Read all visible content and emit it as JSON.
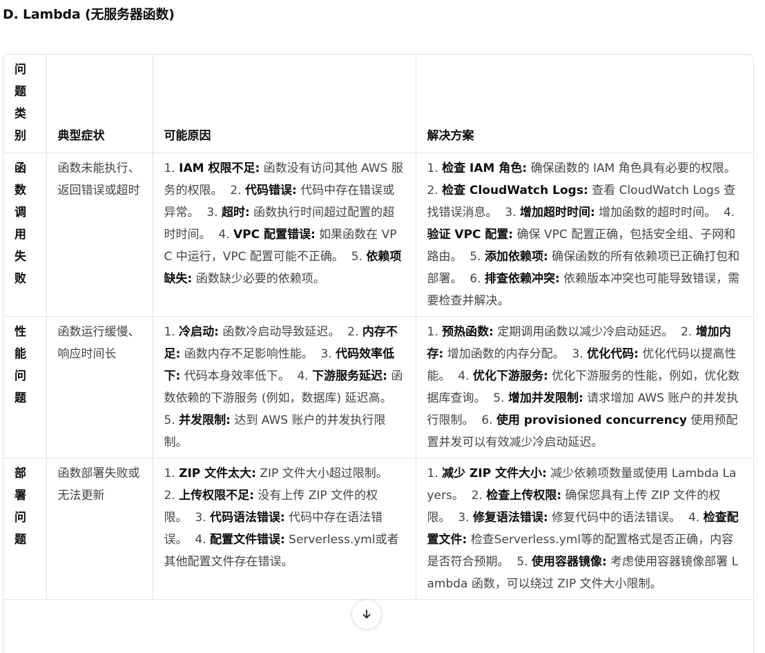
{
  "heading": "D. Lambda (无服务器函数)",
  "table": {
    "headers": [
      "问题类别",
      "典型症状",
      "可能原因",
      "解决方案"
    ],
    "rows": [
      {
        "category": "函数调用失败",
        "symptom": "函数未能执行、返回错误或超时",
        "causes": [
          {
            "num": "1.",
            "title": "IAM 权限不足:",
            "text": "函数没有访问其他 AWS 服务的权限。"
          },
          {
            "num": "2.",
            "title": "代码错误:",
            "text": "代码中存在错误或异常。"
          },
          {
            "num": "3.",
            "title": "超时:",
            "text": "函数执行时间超过配置的超时时间。"
          },
          {
            "num": "4.",
            "title": "VPC 配置错误:",
            "text": "如果函数在 VPC 中运行，VPC 配置可能不正确。"
          },
          {
            "num": "5.",
            "title": "依赖项缺失:",
            "text": "函数缺少必要的依赖项。"
          }
        ],
        "solutions": [
          {
            "num": "1.",
            "title": "检查 IAM 角色:",
            "text": "确保函数的 IAM 角色具有必要的权限。"
          },
          {
            "num": "2.",
            "title": "检查 CloudWatch Logs:",
            "text": "查看 CloudWatch Logs 查找错误消息。"
          },
          {
            "num": "3.",
            "title": "增加超时时间:",
            "text": "增加函数的超时时间。"
          },
          {
            "num": "4.",
            "title": "验证 VPC 配置:",
            "text": "确保 VPC 配置正确，包括安全组、子网和路由。"
          },
          {
            "num": "5.",
            "title": "添加依赖项:",
            "text": "确保函数的所有依赖项已正确打包和部署。"
          },
          {
            "num": "6.",
            "title": "排查依赖冲突:",
            "text": "依赖版本冲突也可能导致错误，需要检查并解决。"
          }
        ]
      },
      {
        "category": "性能问题",
        "symptom": "函数运行缓慢、响应时间长",
        "causes": [
          {
            "num": "1.",
            "title": "冷启动:",
            "text": "函数冷启动导致延迟。"
          },
          {
            "num": "2.",
            "title": "内存不足:",
            "text": "函数内存不足影响性能。"
          },
          {
            "num": "3.",
            "title": "代码效率低下:",
            "text": "代码本身效率低下。"
          },
          {
            "num": "4.",
            "title": "下游服务延迟:",
            "text": "函数依赖的下游服务 (例如，数据库) 延迟高。"
          },
          {
            "num": "5.",
            "title": "并发限制:",
            "text": "达到 AWS 账户的并发执行限制。"
          }
        ],
        "solutions": [
          {
            "num": "1.",
            "title": "预热函数:",
            "text": "定期调用函数以减少冷启动延迟。"
          },
          {
            "num": "2.",
            "title": "增加内存:",
            "text": "增加函数的内存分配。"
          },
          {
            "num": "3.",
            "title": "优化代码:",
            "text": "优化代码以提高性能。"
          },
          {
            "num": "4.",
            "title": "优化下游服务:",
            "text": "优化下游服务的性能，例如，优化数据库查询。"
          },
          {
            "num": "5.",
            "title": "增加并发限制:",
            "text": "请求增加 AWS 账户的并发执行限制。"
          },
          {
            "num": "6.",
            "title": "使用 provisioned concurrency",
            "text": "使用预配置并发可以有效减少冷启动延迟。"
          }
        ]
      },
      {
        "category": "部署问题",
        "symptom": "函数部署失败或无法更新",
        "causes": [
          {
            "num": "1.",
            "title": "ZIP 文件太大:",
            "text": "ZIP 文件大小超过限制。"
          },
          {
            "num": "2.",
            "title": "上传权限不足:",
            "text": "没有上传 ZIP 文件的权限。"
          },
          {
            "num": "3.",
            "title": "代码语法错误:",
            "text": "代码中存在语法错误。"
          },
          {
            "num": "4.",
            "title": "配置文件错误:",
            "text": "Serverless.yml或者其他配置文件存在错误。"
          }
        ],
        "solutions": [
          {
            "num": "1.",
            "title": "减少 ZIP 文件大小:",
            "text": "减少依赖项数量或使用 Lambda Layers。"
          },
          {
            "num": "2.",
            "title": "检查上传权限:",
            "text": "确保您具有上传 ZIP 文件的权限。"
          },
          {
            "num": "3.",
            "title": "修复语法错误:",
            "text": "修复代码中的语法错误。"
          },
          {
            "num": "4.",
            "title": "检查配置文件:",
            "text": "检查Serverless.yml等的配置格式是否正确，内容是否符合预期。"
          },
          {
            "num": "5.",
            "title": "使用容器镜像:",
            "text": "考虑使用容器镜像部署 Lambda 函数，可以绕过 ZIP 文件大小限制。"
          }
        ]
      }
    ]
  },
  "scroll_button": {
    "icon": "arrow-down-icon"
  }
}
